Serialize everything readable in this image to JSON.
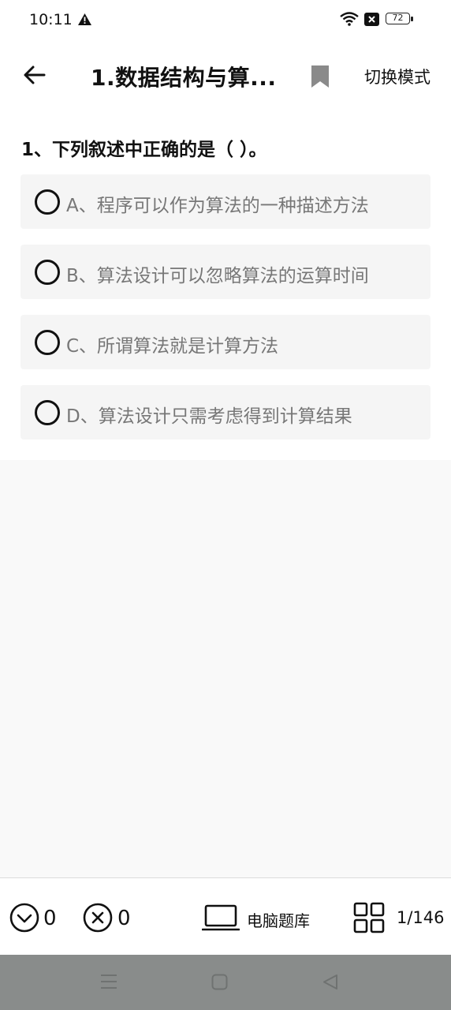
{
  "status_bar": {
    "time": "10:11",
    "battery": "72"
  },
  "toolbar": {
    "title": "1.数据结构与算...",
    "mode_label": "切换模式"
  },
  "question": {
    "text": "1、下列叙述中正确的是（ ）。",
    "options": [
      {
        "label": "A、程序可以作为算法的一种描述方法"
      },
      {
        "label": "B、算法设计可以忽略算法的运算时间"
      },
      {
        "label": "C、所谓算法就是计算方法"
      },
      {
        "label": "D、算法设计只需考虑得到计算结果"
      }
    ]
  },
  "bottom_bar": {
    "correct_count": "0",
    "wrong_count": "0",
    "pc_bank_label": "电脑题库",
    "page_counter": "1/146"
  },
  "icons": {
    "back": "arrow-left-icon",
    "bookmark": "bookmark-icon",
    "correct": "check-circle-icon",
    "wrong": "x-circle-icon",
    "laptop": "laptop-icon",
    "grid": "grid-icon"
  },
  "colors": {
    "option_bg": "#f5f5f5",
    "option_text": "#777777",
    "nav_bar": "#898c8b",
    "bookmark": "#8a8a8a"
  }
}
